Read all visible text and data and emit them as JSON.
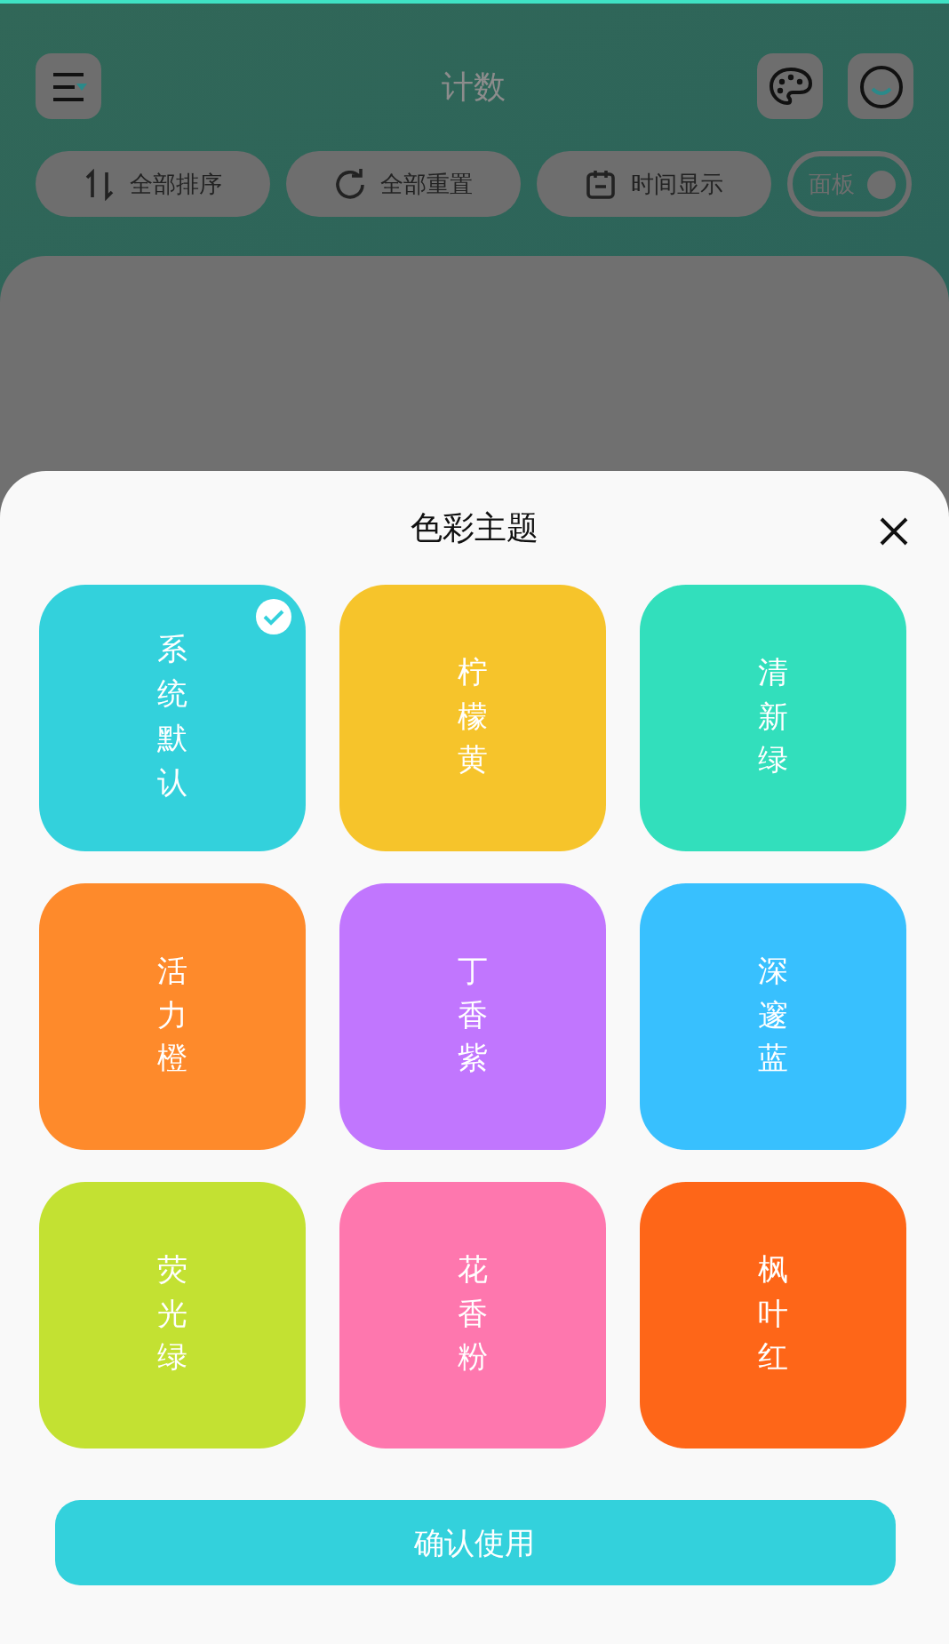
{
  "header": {
    "title": "计数"
  },
  "actions": [
    {
      "label": "全部排序",
      "kind": "sort"
    },
    {
      "label": "全部重置",
      "kind": "reset"
    },
    {
      "label": "时间显示",
      "kind": "time"
    }
  ],
  "panel_toggle": {
    "label": "面板",
    "on": true
  },
  "sheet": {
    "title": "色彩主题",
    "themes": [
      {
        "name": "系统默认",
        "color": "#33d1dc",
        "selected": true
      },
      {
        "name": "柠檬黄",
        "color": "#f6c42b",
        "selected": false
      },
      {
        "name": "清新绿",
        "color": "#32dfbc",
        "selected": false
      },
      {
        "name": "活力橙",
        "color": "#fe8a2b",
        "selected": false
      },
      {
        "name": "丁香紫",
        "color": "#c176fe",
        "selected": false
      },
      {
        "name": "深邃蓝",
        "color": "#38c0fe",
        "selected": false
      },
      {
        "name": "荧光绿",
        "color": "#c3e132",
        "selected": false
      },
      {
        "name": "花香粉",
        "color": "#fe77ae",
        "selected": false
      },
      {
        "name": "枫叶红",
        "color": "#fe6618",
        "selected": false
      }
    ],
    "confirm": "确认使用"
  }
}
